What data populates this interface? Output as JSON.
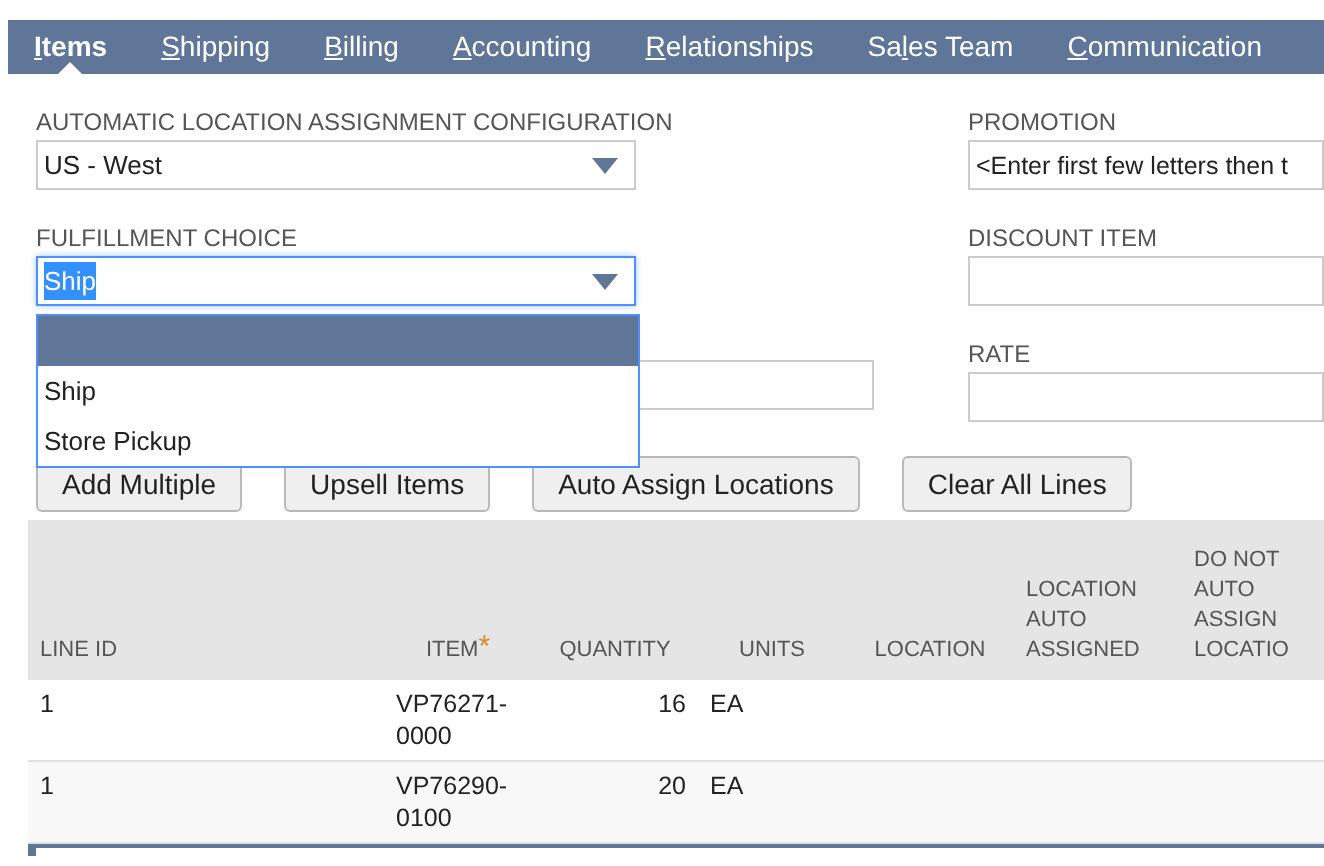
{
  "tabs": [
    {
      "key": "I",
      "after": "tems",
      "selected": true
    },
    {
      "key": "S",
      "after": "hipping",
      "selected": false
    },
    {
      "key": "B",
      "after": "illing",
      "selected": false
    },
    {
      "key": "A",
      "after": "ccounting",
      "selected": false
    },
    {
      "key": "R",
      "after": "elationships",
      "selected": false
    },
    {
      "before": "Sa",
      "key": "l",
      "after": "es Team",
      "selected": false
    },
    {
      "key": "C",
      "after": "ommunication",
      "selected": false
    }
  ],
  "left_fields": [
    {
      "label": "AUTOMATIC LOCATION ASSIGNMENT CONFIGURATION",
      "kind": "select",
      "value": "US - West",
      "focused": false
    },
    {
      "label": "FULFILLMENT CHOICE",
      "kind": "select",
      "value": "Ship",
      "focused": true
    }
  ],
  "dropdown_options": [
    {
      "selected": true
    },
    {
      "text": "Ship",
      "selected": false
    },
    {
      "text": "Store Pickup",
      "selected": false
    }
  ],
  "right_fields": [
    {
      "label": "PROMOTION",
      "placeholder": "<Enter first few letters then t"
    },
    {
      "label": "DISCOUNT ITEM"
    },
    {
      "label": "RATE"
    }
  ],
  "buttons": [
    "Add Multiple",
    "Upsell Items",
    "Auto Assign Locations",
    "Clear All Lines"
  ],
  "table": {
    "columns": [
      {
        "label": "LINE ID"
      },
      {
        "label": "ITEM",
        "required_mark": "*"
      },
      {
        "label": "QUANTITY"
      },
      {
        "label": "UNITS"
      },
      {
        "label": "LOCATION"
      },
      {
        "label": "LOCATION AUTO ASSIGNED"
      },
      {
        "label": "DO NOT AUTO ASSIGN LOCATIO"
      }
    ],
    "rows": [
      [
        "1",
        "VP76271-0000",
        "16",
        "EA",
        "",
        "",
        ""
      ],
      [
        "1",
        "VP76290-0100",
        "20",
        "EA",
        "",
        "",
        ""
      ]
    ]
  }
}
